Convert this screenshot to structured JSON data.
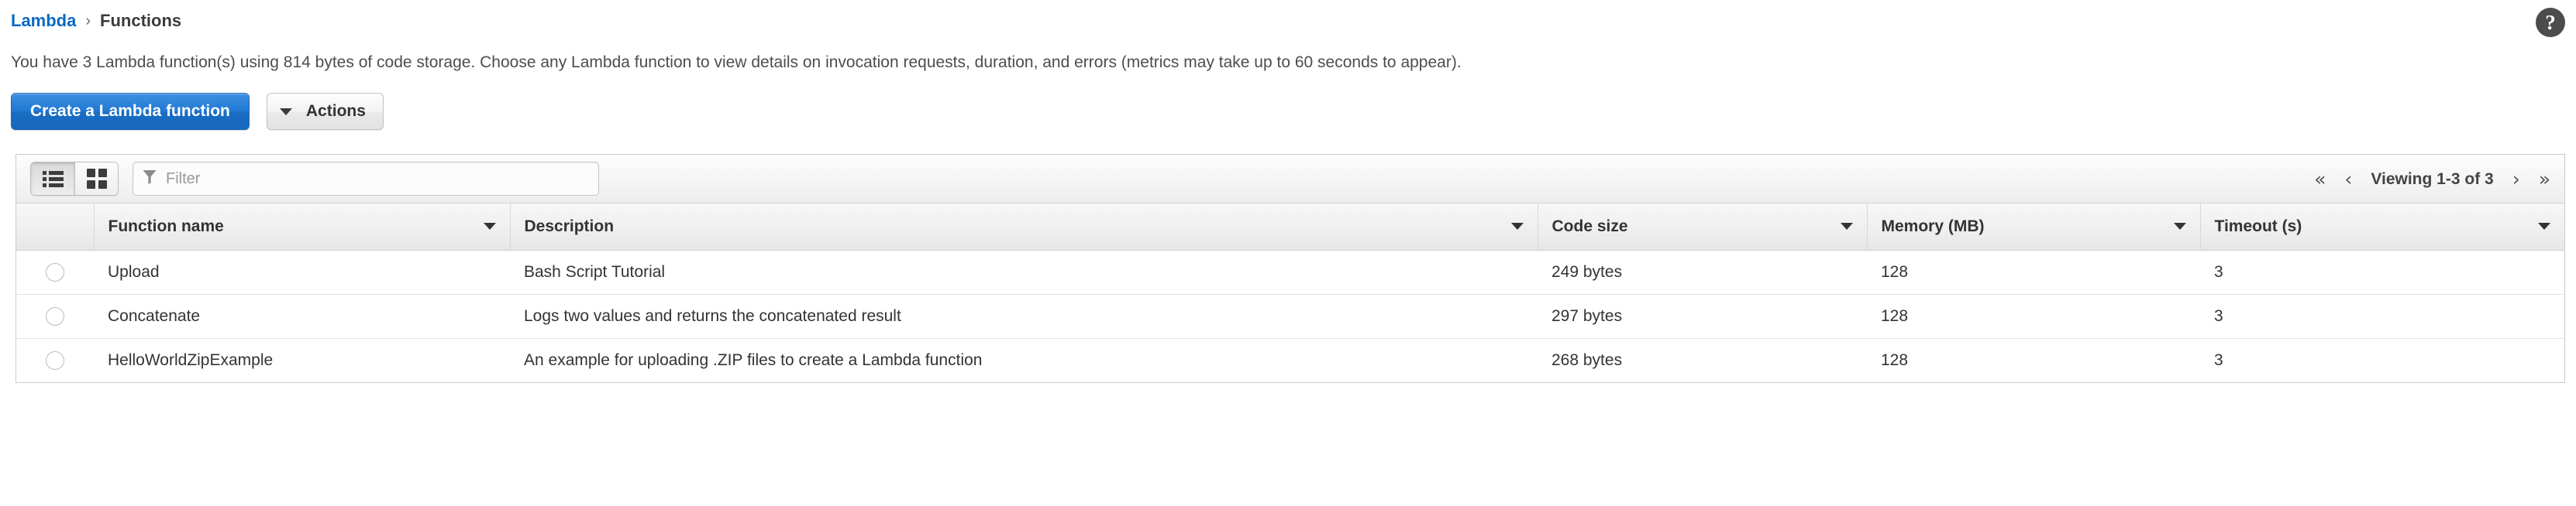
{
  "breadcrumb": {
    "root_label": "Lambda",
    "separator": "›",
    "current_label": "Functions"
  },
  "help": {
    "icon": "question-mark-circle-icon",
    "glyph": "?"
  },
  "page": {
    "description": "You have 3 Lambda function(s) using 814 bytes of code storage. Choose any Lambda function to view details on invocation requests, duration, and errors (metrics may take up to 60 seconds to appear)."
  },
  "actions": {
    "create_label": "Create a Lambda function",
    "actions_label": "Actions",
    "actions_caret_icon": "caret-down-icon"
  },
  "toolbar": {
    "list_view_icon": "list-view-icon",
    "grid_view_icon": "grid-view-icon",
    "active_view": "list",
    "filter_icon": "funnel-icon",
    "filter_placeholder": "Filter",
    "filter_value": ""
  },
  "pagination": {
    "first_icon": "«",
    "prev_icon": "‹",
    "label": "Viewing 1-3 of 3",
    "next_icon": "›",
    "last_icon": "»"
  },
  "table": {
    "columns": [
      {
        "label": "Function name",
        "sortable": true
      },
      {
        "label": "Description",
        "sortable": true
      },
      {
        "label": "Code size",
        "sortable": true
      },
      {
        "label": "Memory (MB)",
        "sortable": true
      },
      {
        "label": "Timeout (s)",
        "sortable": true
      }
    ],
    "rows": [
      {
        "selected": false,
        "function_name": "Upload",
        "description": "Bash Script Tutorial",
        "code_size": "249 bytes",
        "memory": "128",
        "timeout": "3"
      },
      {
        "selected": false,
        "function_name": "Concatenate",
        "description": "Logs two values and returns the concatenated result",
        "code_size": "297 bytes",
        "memory": "128",
        "timeout": "3"
      },
      {
        "selected": false,
        "function_name": "HelloWorldZipExample",
        "description": "An example for uploading .ZIP files to create a Lambda function",
        "code_size": "268 bytes",
        "memory": "128",
        "timeout": "3"
      }
    ]
  },
  "colors": {
    "link": "#0969c3",
    "primary_button": "#2079d4",
    "panel_border": "#c9c9c9",
    "text": "#333333"
  }
}
